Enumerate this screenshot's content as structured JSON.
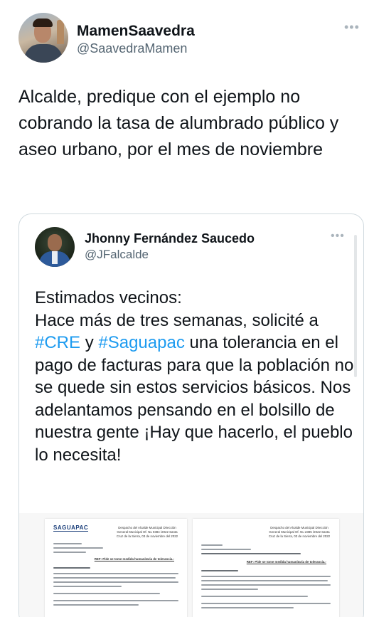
{
  "tweet": {
    "author_name": "MamenSaavedra",
    "author_handle": "@SaavedraMamen",
    "more_label": "•••",
    "text": "Alcalde, predique con el ejemplo no cobrando la tasa de alumbrado público y aseo urbano, por el mes de noviembre"
  },
  "quoted_tweet": {
    "author_name": "Jhonny Fernández Saucedo",
    "author_handle": "@JFalcalde",
    "more_label": "•••",
    "text_segments": {
      "part1": "Estimados vecinos:\nHace más de tres semanas, solicité a ",
      "hashtag1": "#CRE",
      "part2": " y ",
      "hashtag2": "#Saguapac",
      "part3": " una tolerancia en el pago de facturas para que la población no se quede sin estos servicios básicos. Nos adelantamos pensando en el bolsillo de nuestra gente ¡Hay que hacerlo, el pueblo lo necesita!"
    },
    "hashtag_color": "#1d9bf0",
    "attached_documents": [
      {
        "logo": "SAGUAPAC",
        "header": "Despacho del Alcalde Municipal Dirección General Municipal Of. Nu 0384 /2022 Santa Cruz de la Sierra, 03 de noviembre del 2022",
        "ref": "REF: Pide se tome medida humanitaria de tolerancia.-"
      },
      {
        "header": "Despacho del Alcalde Municipal Dirección General Municipal Of. Nu 2385 /2022 Santa Cruz de la Sierra, 03 de noviembre del 2022",
        "ref": "REF: Pide se tome medida humanitaria de tolerancia.-"
      }
    ]
  },
  "colors": {
    "text_primary": "#0f1419",
    "text_secondary": "#536471",
    "border": "#cfd9de",
    "link": "#1d9bf0"
  }
}
